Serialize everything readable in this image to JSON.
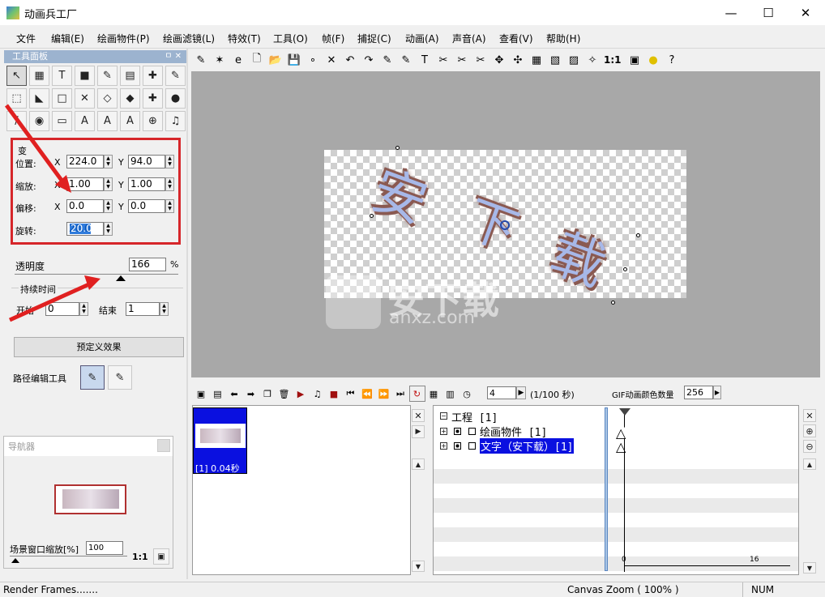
{
  "window": {
    "title": "动画兵工厂",
    "min": "—",
    "max": "☐",
    "close": "✕"
  },
  "menu": [
    "文件",
    "编辑(E)",
    "绘画物件(P)",
    "绘画滤镜(L)",
    "特效(T)",
    "工具(O)",
    "帧(F)",
    "捕捉(C)",
    "动画(A)",
    "声音(A)",
    "查看(V)",
    "帮助(H)"
  ],
  "toolpanel": {
    "title": "工具面板",
    "pin": "ㅁ ✕"
  },
  "tools": [
    "↖",
    "▦",
    "T",
    "■",
    "✎",
    "▤",
    "✚",
    "✎",
    "⬚",
    "◣",
    "□",
    "✕",
    "◇",
    "◆",
    "✚",
    "●",
    "/",
    "◉",
    "▭",
    "A",
    "A",
    "A",
    "⊕",
    "♫"
  ],
  "transform": {
    "section": "变",
    "position_label": "位置:",
    "pos_x_label": "X",
    "pos_x": "224.0",
    "pos_y_label": "Y",
    "pos_y": "94.0",
    "scale_label": "缩放:",
    "scale_x": "1.00",
    "scale_y": "1.00",
    "offset_label": "偏移:",
    "off_x_label": "X",
    "off_x": "0.0",
    "off_y_label": "Y",
    "off_y": "0.0",
    "rotate_label": "旋转:",
    "rotate": "20.0"
  },
  "opacity": {
    "label": "透明度",
    "value": "166",
    "unit": "%",
    "level": 0.65
  },
  "duration": {
    "label": "持续时间",
    "start_label": "开始",
    "start": "0",
    "end_label": "结束",
    "end": "1"
  },
  "preset_button": "预定义效果",
  "path_tool_label": "路径编辑工具",
  "navigator": {
    "title": "导航器",
    "zoom_label": "场景窗口缩放[%]",
    "zoom": "100",
    "one_to_one": "1:1"
  },
  "top_toolbar": {
    "one_to_one": "1:1"
  },
  "canvas": {
    "watermark_main": "安下载",
    "watermark_sub": "anxz.com",
    "artwork_text": [
      "安",
      "下",
      "载"
    ]
  },
  "timeline_toolbar": {
    "frame": "4",
    "frame_unit": "(1/100 秒)",
    "gif_label": "GIF动画颜色数量",
    "gif_colors": "256"
  },
  "frames": [
    {
      "label": "[1] 0.04秒"
    }
  ],
  "tree": [
    {
      "prefix": "⊟",
      "label": "工程 [1]"
    },
    {
      "prefix": "⊞",
      "label": "绘画物件 [1]"
    },
    {
      "prefix": "⊞",
      "label": "文字（安下载）[1]"
    }
  ],
  "ruler": {
    "start": "0",
    "mid": "16"
  },
  "status": {
    "left": "Render Frames.......",
    "zoom": "Canvas Zoom ( 100% )",
    "num": "NUM"
  }
}
